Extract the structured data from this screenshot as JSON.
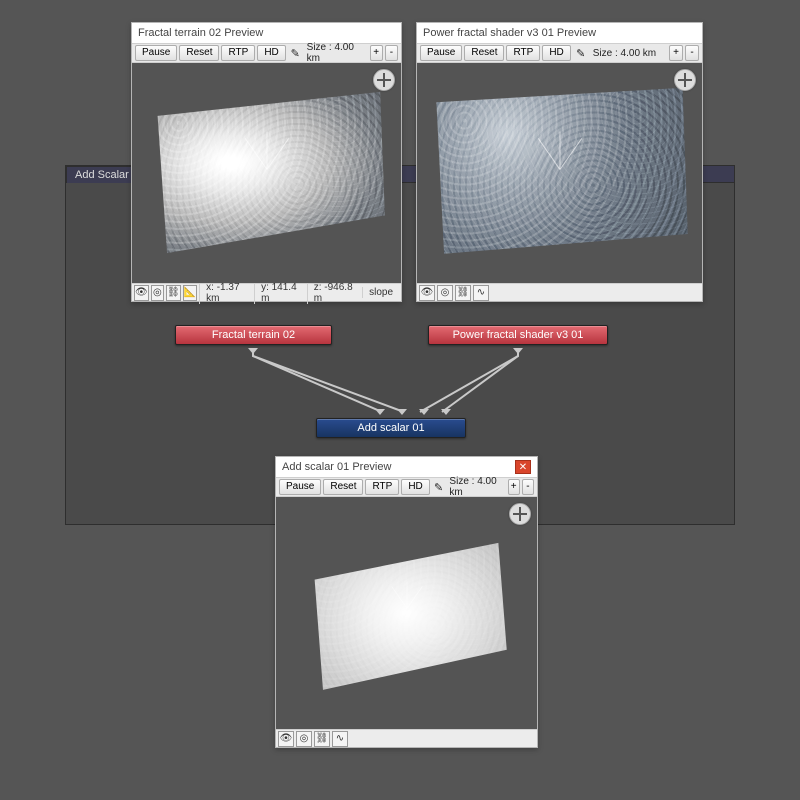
{
  "editor": {
    "tab_label": "Add Scalar"
  },
  "nodes": {
    "fractal_terrain": {
      "label": "Fractal terrain 02"
    },
    "power_fractal": {
      "label": "Power fractal shader v3 01"
    },
    "add_scalar": {
      "label": "Add scalar 01"
    }
  },
  "toolbar": {
    "pause": "Pause",
    "reset": "Reset",
    "rtp": "RTP",
    "hd": "HD",
    "size_label": "Size : 4.00 km",
    "plus": "+",
    "minus": "-"
  },
  "windows": {
    "left": {
      "title": "Fractal terrain 02 Preview",
      "status": {
        "x": "x: -1.37 km",
        "y": "y: 141.4 m",
        "z": "z: -946.8 m",
        "slope": "slope"
      }
    },
    "right": {
      "title": "Power fractal shader v3 01 Preview"
    },
    "bottom": {
      "title": "Add scalar 01 Preview",
      "close": "✕"
    }
  }
}
